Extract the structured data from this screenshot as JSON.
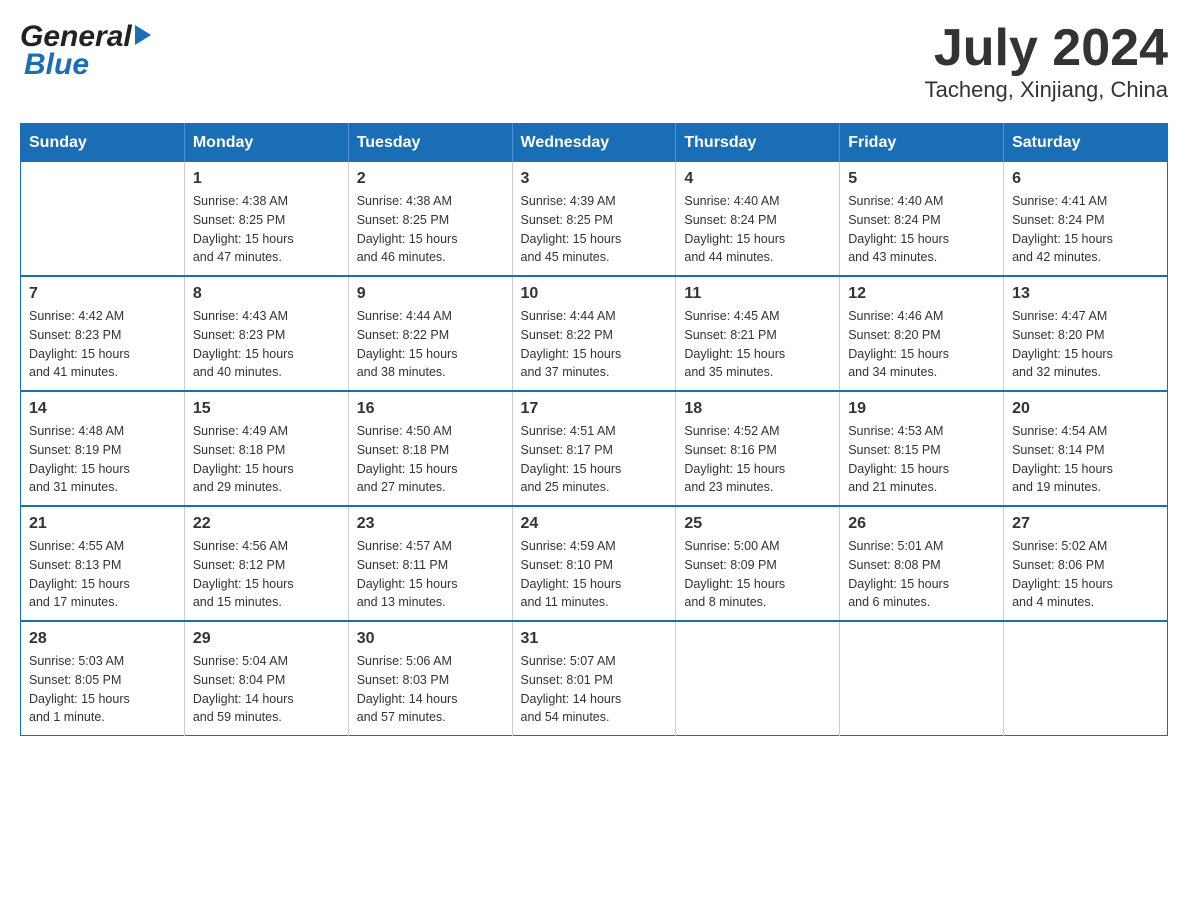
{
  "header": {
    "logo_general": "General",
    "logo_blue": "Blue",
    "title": "July 2024",
    "subtitle": "Tacheng, Xinjiang, China"
  },
  "days_of_week": [
    "Sunday",
    "Monday",
    "Tuesday",
    "Wednesday",
    "Thursday",
    "Friday",
    "Saturday"
  ],
  "weeks": [
    {
      "days": [
        {
          "number": "",
          "info": ""
        },
        {
          "number": "1",
          "info": "Sunrise: 4:38 AM\nSunset: 8:25 PM\nDaylight: 15 hours\nand 47 minutes."
        },
        {
          "number": "2",
          "info": "Sunrise: 4:38 AM\nSunset: 8:25 PM\nDaylight: 15 hours\nand 46 minutes."
        },
        {
          "number": "3",
          "info": "Sunrise: 4:39 AM\nSunset: 8:25 PM\nDaylight: 15 hours\nand 45 minutes."
        },
        {
          "number": "4",
          "info": "Sunrise: 4:40 AM\nSunset: 8:24 PM\nDaylight: 15 hours\nand 44 minutes."
        },
        {
          "number": "5",
          "info": "Sunrise: 4:40 AM\nSunset: 8:24 PM\nDaylight: 15 hours\nand 43 minutes."
        },
        {
          "number": "6",
          "info": "Sunrise: 4:41 AM\nSunset: 8:24 PM\nDaylight: 15 hours\nand 42 minutes."
        }
      ]
    },
    {
      "days": [
        {
          "number": "7",
          "info": "Sunrise: 4:42 AM\nSunset: 8:23 PM\nDaylight: 15 hours\nand 41 minutes."
        },
        {
          "number": "8",
          "info": "Sunrise: 4:43 AM\nSunset: 8:23 PM\nDaylight: 15 hours\nand 40 minutes."
        },
        {
          "number": "9",
          "info": "Sunrise: 4:44 AM\nSunset: 8:22 PM\nDaylight: 15 hours\nand 38 minutes."
        },
        {
          "number": "10",
          "info": "Sunrise: 4:44 AM\nSunset: 8:22 PM\nDaylight: 15 hours\nand 37 minutes."
        },
        {
          "number": "11",
          "info": "Sunrise: 4:45 AM\nSunset: 8:21 PM\nDaylight: 15 hours\nand 35 minutes."
        },
        {
          "number": "12",
          "info": "Sunrise: 4:46 AM\nSunset: 8:20 PM\nDaylight: 15 hours\nand 34 minutes."
        },
        {
          "number": "13",
          "info": "Sunrise: 4:47 AM\nSunset: 8:20 PM\nDaylight: 15 hours\nand 32 minutes."
        }
      ]
    },
    {
      "days": [
        {
          "number": "14",
          "info": "Sunrise: 4:48 AM\nSunset: 8:19 PM\nDaylight: 15 hours\nand 31 minutes."
        },
        {
          "number": "15",
          "info": "Sunrise: 4:49 AM\nSunset: 8:18 PM\nDaylight: 15 hours\nand 29 minutes."
        },
        {
          "number": "16",
          "info": "Sunrise: 4:50 AM\nSunset: 8:18 PM\nDaylight: 15 hours\nand 27 minutes."
        },
        {
          "number": "17",
          "info": "Sunrise: 4:51 AM\nSunset: 8:17 PM\nDaylight: 15 hours\nand 25 minutes."
        },
        {
          "number": "18",
          "info": "Sunrise: 4:52 AM\nSunset: 8:16 PM\nDaylight: 15 hours\nand 23 minutes."
        },
        {
          "number": "19",
          "info": "Sunrise: 4:53 AM\nSunset: 8:15 PM\nDaylight: 15 hours\nand 21 minutes."
        },
        {
          "number": "20",
          "info": "Sunrise: 4:54 AM\nSunset: 8:14 PM\nDaylight: 15 hours\nand 19 minutes."
        }
      ]
    },
    {
      "days": [
        {
          "number": "21",
          "info": "Sunrise: 4:55 AM\nSunset: 8:13 PM\nDaylight: 15 hours\nand 17 minutes."
        },
        {
          "number": "22",
          "info": "Sunrise: 4:56 AM\nSunset: 8:12 PM\nDaylight: 15 hours\nand 15 minutes."
        },
        {
          "number": "23",
          "info": "Sunrise: 4:57 AM\nSunset: 8:11 PM\nDaylight: 15 hours\nand 13 minutes."
        },
        {
          "number": "24",
          "info": "Sunrise: 4:59 AM\nSunset: 8:10 PM\nDaylight: 15 hours\nand 11 minutes."
        },
        {
          "number": "25",
          "info": "Sunrise: 5:00 AM\nSunset: 8:09 PM\nDaylight: 15 hours\nand 8 minutes."
        },
        {
          "number": "26",
          "info": "Sunrise: 5:01 AM\nSunset: 8:08 PM\nDaylight: 15 hours\nand 6 minutes."
        },
        {
          "number": "27",
          "info": "Sunrise: 5:02 AM\nSunset: 8:06 PM\nDaylight: 15 hours\nand 4 minutes."
        }
      ]
    },
    {
      "days": [
        {
          "number": "28",
          "info": "Sunrise: 5:03 AM\nSunset: 8:05 PM\nDaylight: 15 hours\nand 1 minute."
        },
        {
          "number": "29",
          "info": "Sunrise: 5:04 AM\nSunset: 8:04 PM\nDaylight: 14 hours\nand 59 minutes."
        },
        {
          "number": "30",
          "info": "Sunrise: 5:06 AM\nSunset: 8:03 PM\nDaylight: 14 hours\nand 57 minutes."
        },
        {
          "number": "31",
          "info": "Sunrise: 5:07 AM\nSunset: 8:01 PM\nDaylight: 14 hours\nand 54 minutes."
        },
        {
          "number": "",
          "info": ""
        },
        {
          "number": "",
          "info": ""
        },
        {
          "number": "",
          "info": ""
        }
      ]
    }
  ]
}
